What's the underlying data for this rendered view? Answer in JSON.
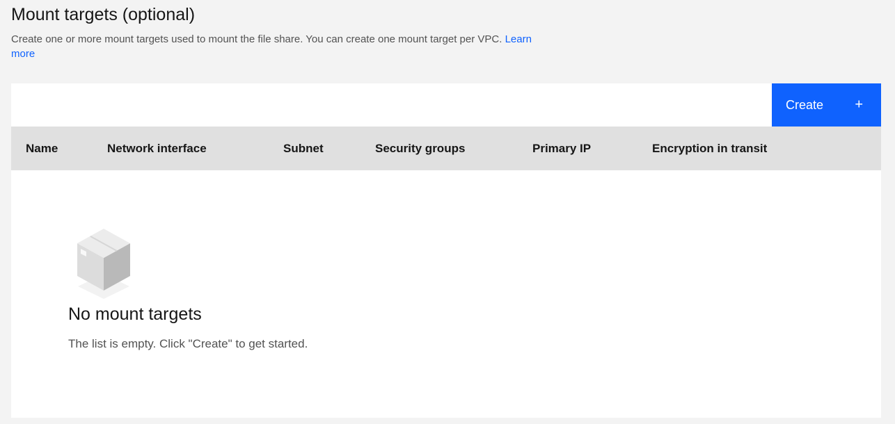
{
  "section": {
    "title": "Mount targets (optional)",
    "description": "Create one or more mount targets used to mount the file share. You can create one mount target per VPC.",
    "learn_more": "Learn more"
  },
  "toolbar": {
    "create_label": "Create",
    "create_icon": "+"
  },
  "table": {
    "columns": [
      "Name",
      "Network interface",
      "Subnet",
      "Security groups",
      "Primary IP",
      "Encryption in transit"
    ]
  },
  "empty_state": {
    "icon": "empty-box-icon",
    "title": "No mount targets",
    "text": "The list is empty. Click \"Create\" to get started."
  },
  "colors": {
    "primary": "#0f62fe",
    "page_bg": "#f3f3f3",
    "header_bg": "#e0e0e0"
  }
}
